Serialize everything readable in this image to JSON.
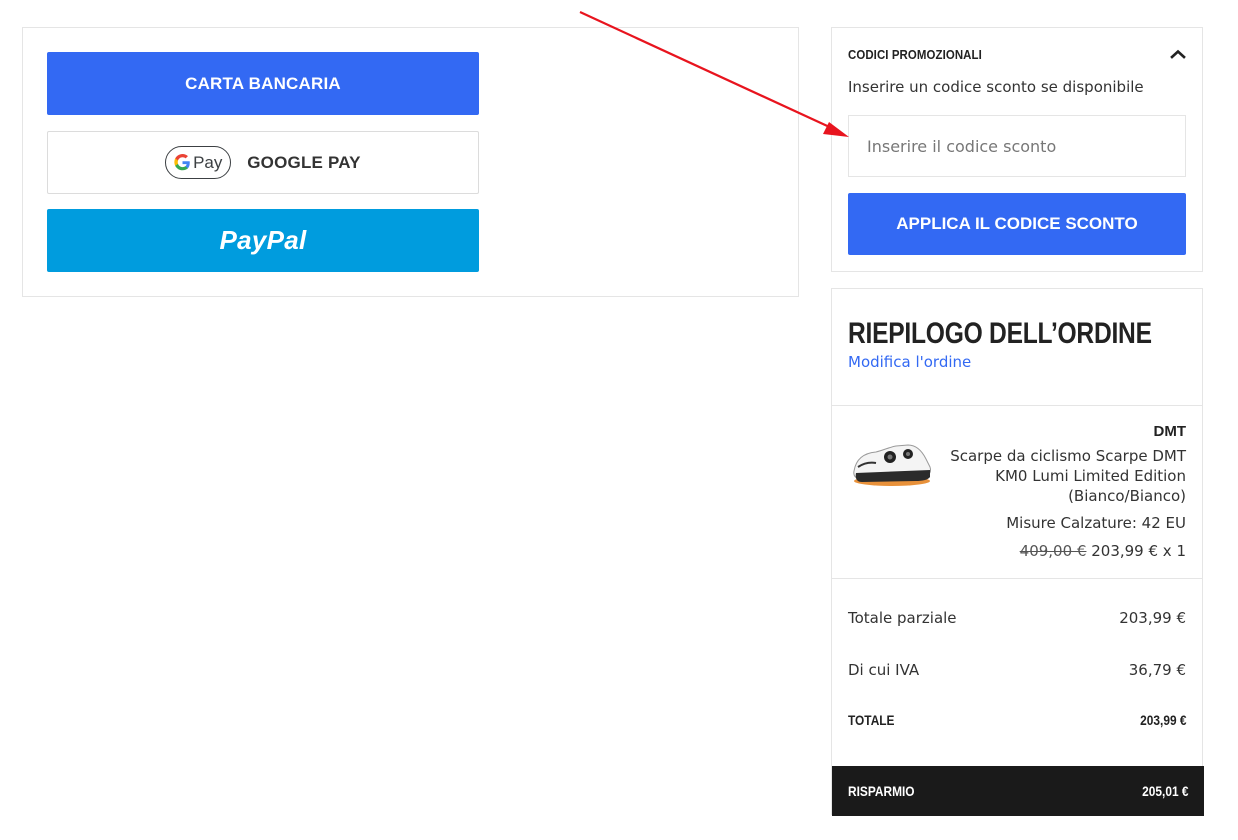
{
  "payment": {
    "card_label": "CARTA BANCARIA",
    "gpay_pay_word": "Pay",
    "gpay_label": "GOOGLE PAY",
    "paypal_label": "PayPal"
  },
  "promo": {
    "title": "CODICI PROMOZIONALI",
    "subtitle": "Inserire un codice sconto se disponibile",
    "input_placeholder": "Inserire il codice sconto",
    "input_value": "",
    "apply_label": "APPLICA IL CODICE SCONTO",
    "collapse_icon": "chevron-up-icon"
  },
  "summary": {
    "title": "RIEPILOGO DELL’ORDINE",
    "edit_link": "Modifica l'ordine",
    "product": {
      "brand": "DMT",
      "name": "Scarpe da ciclismo Scarpe DMT KM0 Lumi Limited Edition (Bianco/Bianco)",
      "size": "Misure Calzature: 42 EU",
      "old_price": "409,00 €",
      "price": "203,99 € x 1"
    },
    "rows": [
      {
        "label": "Totale parziale",
        "value": "203,99 €"
      },
      {
        "label": "Di cui IVA",
        "value": "36,79 €"
      }
    ],
    "total": {
      "label": "TOTALE",
      "value": "203,99 €"
    },
    "savings": {
      "label": "RISPARMIO",
      "value": "205,01 €"
    }
  },
  "colors": {
    "primary_blue": "#3369f3",
    "paypal_blue": "#009cde",
    "savings_bar": "#1a1a1a",
    "annotation_arrow": "#e8141e"
  }
}
